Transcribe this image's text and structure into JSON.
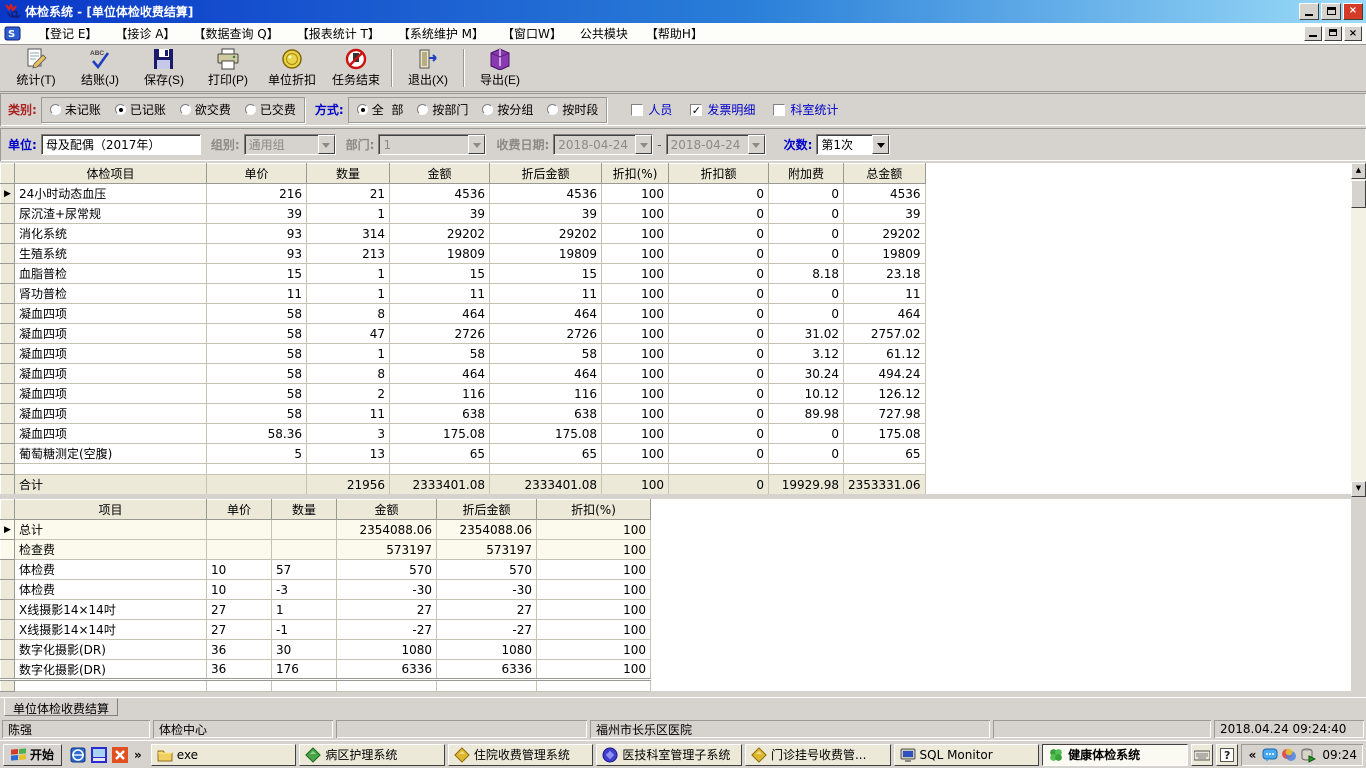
{
  "colors": {
    "titlebar_start": "#0a37c8",
    "titlebar_mid": "#2a7fd8",
    "titlebar_end": "#9cdcf8",
    "close_red": "#d43c28",
    "label_blue": "#0000cc",
    "label_red": "#aa2222",
    "grid_header_bg": "#ece9d8"
  },
  "window": {
    "title": "体检系统 -  [单位体检收费结算]",
    "controls": [
      "minimize",
      "restore",
      "close"
    ]
  },
  "menu": {
    "items": [
      "【登记 E】",
      "【接诊 A】",
      "【数据查询 Q】",
      "【报表统计 T】",
      "【系统维护 M】",
      "【窗口W】",
      "公共模块",
      "【帮助H】"
    ]
  },
  "toolbar": {
    "groups": [
      [
        {
          "icon": "stats-icon",
          "label": "统计(T)"
        },
        {
          "icon": "settle-icon",
          "label": "结账(J)"
        },
        {
          "icon": "save-icon",
          "label": "保存(S)"
        },
        {
          "icon": "print-icon",
          "label": "打印(P)"
        },
        {
          "icon": "unit-discount-icon",
          "label": "单位折扣"
        },
        {
          "icon": "end-task-icon",
          "label": "任务结束"
        }
      ],
      [
        {
          "icon": "exit-icon",
          "label": "退出(X)"
        }
      ],
      [
        {
          "icon": "export-icon",
          "label": "导出(E)"
        }
      ]
    ]
  },
  "filters": {
    "category_label": "类别:",
    "category_options": [
      {
        "label": "未记账",
        "selected": false
      },
      {
        "label": "已记账",
        "selected": true
      },
      {
        "label": "欲交费",
        "selected": false
      },
      {
        "label": "已交费",
        "selected": false
      }
    ],
    "mode_label": "方式:",
    "mode_options": [
      {
        "label": "全  部",
        "selected": true
      },
      {
        "label": "按部门",
        "selected": false
      },
      {
        "label": "按分组",
        "selected": false
      },
      {
        "label": "按时段",
        "selected": false
      }
    ],
    "checkboxes": [
      {
        "label": "人员",
        "checked": false
      },
      {
        "label": "发票明细",
        "checked": true
      },
      {
        "label": "科室统计",
        "checked": false
      }
    ],
    "unit_label": "单位:",
    "unit_value": "母及配偶（2017年）",
    "group_label": "组别:",
    "group_value": "通用组",
    "dept_label": "部门:",
    "dept_value": "1",
    "date_label": "收费日期:",
    "date_from": "2018-04-24",
    "date_separator": "-",
    "date_to": "2018-04-24",
    "times_label": "次数:",
    "times_value": "第1次"
  },
  "grid1": {
    "headers": [
      "体检项目",
      "单价",
      "数量",
      "金额",
      "折后金额",
      "折扣(%)",
      "折扣额",
      "附加费",
      "总金额"
    ],
    "rows": [
      [
        "24小时动态血压",
        "216",
        "21",
        "4536",
        "4536",
        "100",
        "0",
        "0",
        "4536"
      ],
      [
        "尿沉渣+尿常规",
        "39",
        "1",
        "39",
        "39",
        "100",
        "0",
        "0",
        "39"
      ],
      [
        "消化系统",
        "93",
        "314",
        "29202",
        "29202",
        "100",
        "0",
        "0",
        "29202"
      ],
      [
        "生殖系统",
        "93",
        "213",
        "19809",
        "19809",
        "100",
        "0",
        "0",
        "19809"
      ],
      [
        "血脂普检",
        "15",
        "1",
        "15",
        "15",
        "100",
        "0",
        "8.18",
        "23.18"
      ],
      [
        "肾功普检",
        "11",
        "1",
        "11",
        "11",
        "100",
        "0",
        "0",
        "11"
      ],
      [
        "凝血四项",
        "58",
        "8",
        "464",
        "464",
        "100",
        "0",
        "0",
        "464"
      ],
      [
        "凝血四项",
        "58",
        "47",
        "2726",
        "2726",
        "100",
        "0",
        "31.02",
        "2757.02"
      ],
      [
        "凝血四项",
        "58",
        "1",
        "58",
        "58",
        "100",
        "0",
        "3.12",
        "61.12"
      ],
      [
        "凝血四项",
        "58",
        "8",
        "464",
        "464",
        "100",
        "0",
        "30.24",
        "494.24"
      ],
      [
        "凝血四项",
        "58",
        "2",
        "116",
        "116",
        "100",
        "0",
        "10.12",
        "126.12"
      ],
      [
        "凝血四项",
        "58",
        "11",
        "638",
        "638",
        "100",
        "0",
        "89.98",
        "727.98"
      ],
      [
        "凝血四项",
        "58.36",
        "3",
        "175.08",
        "175.08",
        "100",
        "0",
        "0",
        "175.08"
      ],
      [
        "葡萄糖测定(空腹)",
        "5",
        "13",
        "65",
        "65",
        "100",
        "0",
        "0",
        "65"
      ]
    ],
    "total_row": [
      "合计",
      "",
      "21956",
      "2333401.08",
      "2333401.08",
      "100",
      "0",
      "19929.98",
      "2353331.06"
    ]
  },
  "grid2": {
    "headers": [
      "项目",
      "单价",
      "数量",
      "金额",
      "折后金额",
      "折扣(%)"
    ],
    "rows": [
      [
        "总计",
        "",
        "",
        "2354088.06",
        "2354088.06",
        "100"
      ],
      [
        "检查费",
        "",
        "",
        "573197",
        "573197",
        "100"
      ],
      [
        "体检费",
        "10",
        "57",
        "570",
        "570",
        "100"
      ],
      [
        "体检费",
        "10",
        "-3",
        "-30",
        "-30",
        "100"
      ],
      [
        "X线摄影14×14吋",
        "27",
        "1",
        "27",
        "27",
        "100"
      ],
      [
        "X线摄影14×14吋",
        "27",
        "-1",
        "-27",
        "-27",
        "100"
      ],
      [
        "数字化摄影(DR)",
        "36",
        "30",
        "1080",
        "1080",
        "100"
      ],
      [
        "数字化摄影(DR)",
        "36",
        "176",
        "6336",
        "6336",
        "100"
      ]
    ]
  },
  "bottom_tab": "单位体检收费结算",
  "statusbar": {
    "panels": [
      "陈强",
      "体检中心",
      "",
      "福州市长乐区医院",
      "",
      "2018.04.24 09:24:40"
    ]
  },
  "taskbar": {
    "start_label": "开始",
    "quick_launch_icons": [
      "ie-launch-icon",
      "desktop-launch-icon",
      "close-app-launch-icon"
    ],
    "overflow_chevron": "»",
    "tasks": [
      {
        "icon": "folder-icon",
        "label": "exe",
        "active": false
      },
      {
        "icon": "ward-nursing-icon",
        "label": "病区护理系统",
        "active": false
      },
      {
        "icon": "inpatient-fee-icon",
        "label": "住院收费管理系统",
        "active": false
      },
      {
        "icon": "medtech-dept-icon",
        "label": "医技科室管理子系统",
        "active": false
      },
      {
        "icon": "outpatient-reg-icon",
        "label": "门诊挂号收费管...",
        "active": false
      },
      {
        "icon": "sql-monitor-icon",
        "label": "SQL Monitor",
        "active": false
      },
      {
        "icon": "health-exam-icon",
        "label": "健康体检系统",
        "active": true
      }
    ],
    "system_buttons": [
      "keyboard-icon",
      "help-icon"
    ],
    "tray_collapse": "«",
    "tray_icons": [
      "chat-icon",
      "tools-icon",
      "db-task-icon"
    ],
    "clock": "09:24"
  }
}
